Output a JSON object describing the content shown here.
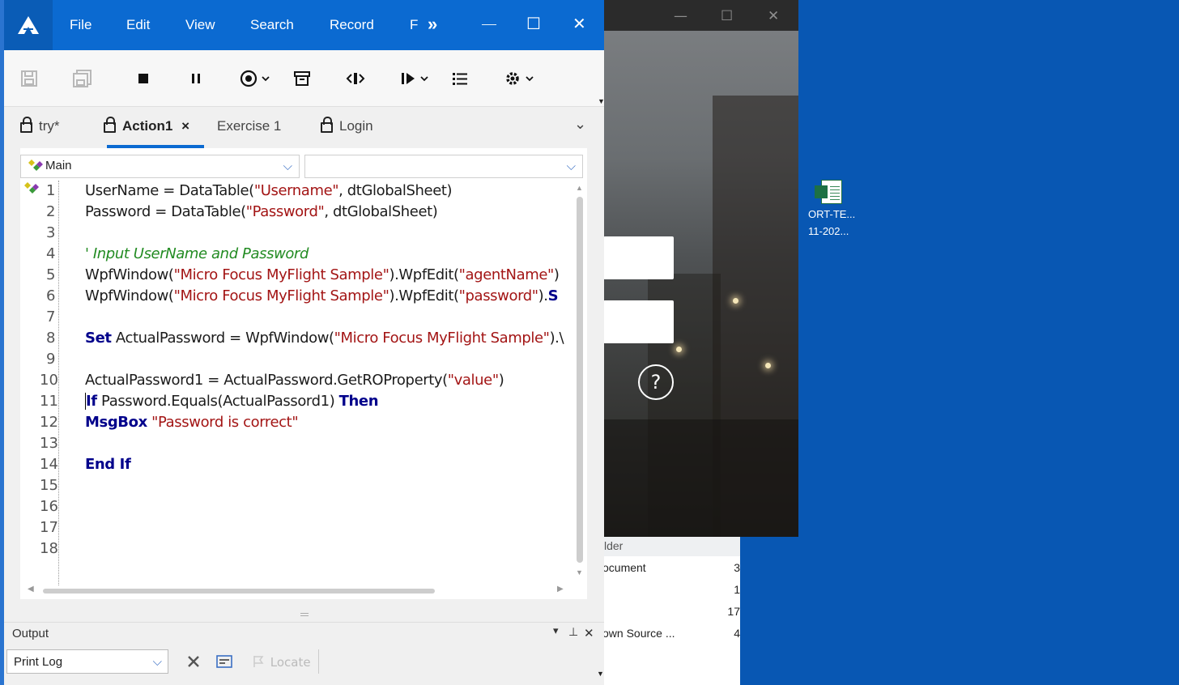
{
  "desktop": {
    "icon_label_line1": "ORT-TE...",
    "icon_label_line2": "11-202..."
  },
  "photo_window": {
    "minimize": "—",
    "maximize": "☐",
    "close": "✕",
    "help": "?"
  },
  "explorer": {
    "header": "lder",
    "rows": [
      {
        "name": "ocument",
        "count": "3"
      },
      {
        "name": "",
        "count": "1"
      },
      {
        "name": "",
        "count": "17"
      },
      {
        "name": "own Source ...",
        "count": "4"
      }
    ]
  },
  "titlebar": {
    "menus": [
      "File",
      "Edit",
      "View",
      "Search",
      "Record",
      "F"
    ],
    "overflow": "»",
    "minimize": "—",
    "maximize": "☐",
    "close": "✕"
  },
  "tabs": {
    "items": [
      "try*",
      "Action1",
      "Exercise 1",
      "Login"
    ],
    "close": "×",
    "overflow": "⌄"
  },
  "editor": {
    "scope_combo": "Main",
    "member_combo": "",
    "line_numbers": [
      "1",
      "2",
      "3",
      "4",
      "5",
      "6",
      "7",
      "8",
      "9",
      "10",
      "11",
      "12",
      "13",
      "14",
      "15",
      "16",
      "17",
      "18"
    ]
  },
  "code": {
    "l1": {
      "a": "UserName = DataTable(",
      "b": "\"Username\"",
      "c": ", dtGlobalSheet)"
    },
    "l2": {
      "a": "Password = DataTable(",
      "b": "\"Password\"",
      "c": ", dtGlobalSheet)"
    },
    "l4": "' Input UserName and Password",
    "l5": {
      "a": "WpfWindow(",
      "b": "\"Micro Focus MyFlight Sample\"",
      "c": ").WpfEdit(",
      "d": "\"agentName\"",
      "e": ")"
    },
    "l6": {
      "a": "WpfWindow(",
      "b": "\"Micro Focus MyFlight Sample\"",
      "c": ").WpfEdit(",
      "d": "\"password\"",
      "e": ").",
      "f": "S"
    },
    "l8": {
      "kw": "Set",
      "a": " ActualPassword = WpfWindow(",
      "b": "\"Micro Focus MyFlight Sample\"",
      "c": ").\\"
    },
    "l10": {
      "a": "ActualPassword1 = ActualPassword.GetROProperty(",
      "b": "\"value\"",
      "c": ")"
    },
    "l11": {
      "kw1": "If",
      "a": " Password.Equals(ActualPassord1) ",
      "kw2": "Then"
    },
    "l12": {
      "kw": "MsgBox",
      "b": " \"Password is correct\""
    },
    "l14": "End If"
  },
  "output": {
    "title": "Output",
    "filter": "Print Log",
    "locate": "Locate",
    "pin": "⊥",
    "close": "✕",
    "dropdown": "▾"
  }
}
